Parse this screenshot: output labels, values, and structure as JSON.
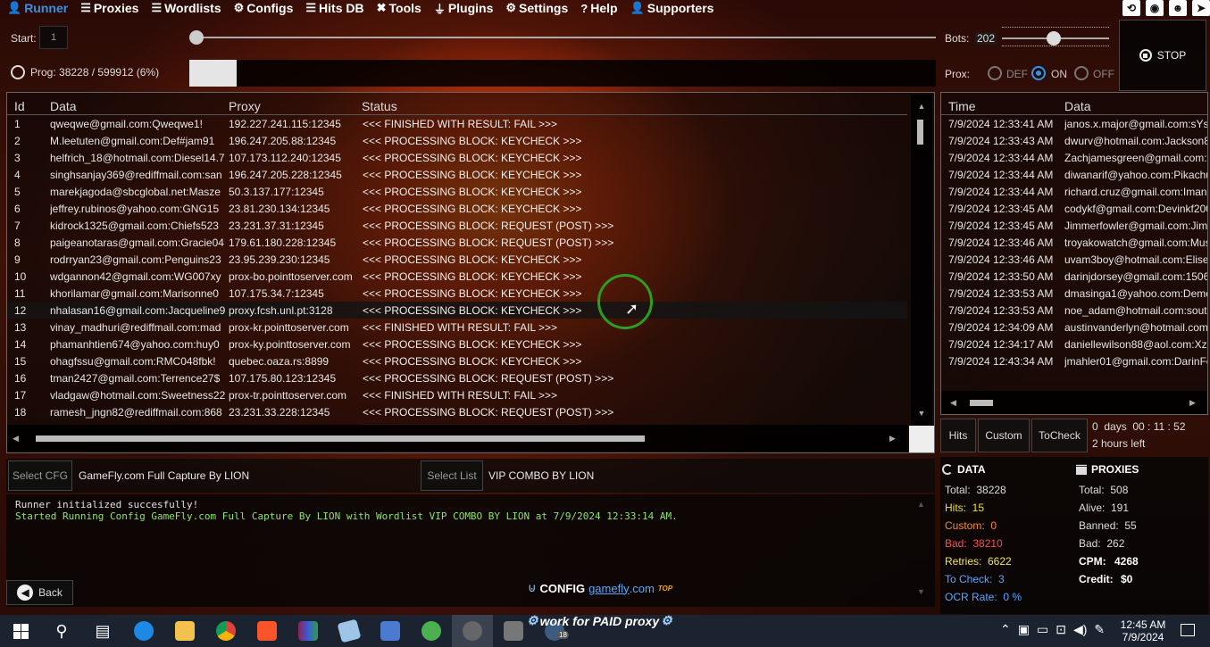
{
  "nav": {
    "items": [
      {
        "label": "Runner",
        "icon": "person-icon",
        "active": true
      },
      {
        "label": "Proxies",
        "icon": "list-icon"
      },
      {
        "label": "Wordlists",
        "icon": "list-icon"
      },
      {
        "label": "Configs",
        "icon": "gear-icon"
      },
      {
        "label": "Hits DB",
        "icon": "list-icon"
      },
      {
        "label": "Tools",
        "icon": "tools-icon"
      },
      {
        "label": "Plugins",
        "icon": "plug-icon"
      },
      {
        "label": "Settings",
        "icon": "gear-icon"
      },
      {
        "label": "Help",
        "icon": "help-icon"
      },
      {
        "label": "Supporters",
        "icon": "person-icon"
      }
    ],
    "right_icons": [
      "history-icon",
      "camera-icon",
      "discord-icon",
      "telegram-icon"
    ]
  },
  "runner": {
    "start_label": "Start:",
    "start_value": "1",
    "prog_label": "Prog: 38228 / 599912 (6%)",
    "progress_fraction": 0.0637,
    "bots_label": "Bots:",
    "bots_value": "202",
    "prox_label": "Prox:",
    "prox_options": [
      "DEF",
      "ON",
      "OFF"
    ],
    "prox_selected": "ON",
    "stop_label": "STOP"
  },
  "main_table": {
    "headers": [
      "Id",
      "Data",
      "Proxy",
      "Status"
    ],
    "rows": [
      [
        "1",
        "qweqwe@gmail.com:Qweqwe1!",
        "192.227.241.115:12345",
        "<<< FINISHED WITH RESULT: FAIL >>>"
      ],
      [
        "2",
        "M.leetuten@gmail.com:Def#jam91",
        "196.247.205.88:12345",
        "<<< PROCESSING BLOCK: KEYCHECK >>>"
      ],
      [
        "3",
        "helfrich_18@hotmail.com:Diesel14.7",
        "107.173.112.240:12345",
        "<<< PROCESSING BLOCK: KEYCHECK >>>"
      ],
      [
        "4",
        "singhsanjay369@rediffmail.com:san",
        "196.247.205.228:12345",
        "<<< PROCESSING BLOCK: KEYCHECK >>>"
      ],
      [
        "5",
        "marekjagoda@sbcglobal.net:Masze",
        "50.3.137.177:12345",
        "<<< PROCESSING BLOCK: KEYCHECK >>>"
      ],
      [
        "6",
        "jeffrey.rubinos@yahoo.com:GNG15",
        "23.81.230.134:12345",
        "<<< PROCESSING BLOCK: KEYCHECK >>>"
      ],
      [
        "7",
        "kidrock1325@gmail.com:Chiefs523",
        "23.231.37.31:12345",
        "<<< PROCESSING BLOCK: REQUEST (POST) >>>"
      ],
      [
        "8",
        "paigeanotaras@gmail.com:Gracie04",
        "179.61.180.228:12345",
        "<<< PROCESSING BLOCK: REQUEST (POST) >>>"
      ],
      [
        "9",
        "rodrryan23@gmail.com:Penguins23",
        "23.95.239.230:12345",
        "<<< PROCESSING BLOCK: KEYCHECK >>>"
      ],
      [
        "10",
        "wdgannon42@gmail.com:WG007xy",
        "prox-bo.pointtoserver.com",
        "<<< PROCESSING BLOCK: KEYCHECK >>>"
      ],
      [
        "11",
        "khorilamar@gmail.com:Marisonne0",
        "107.175.34.7:12345",
        "<<< PROCESSING BLOCK: KEYCHECK >>>"
      ],
      [
        "12",
        "nhalasan16@gmail.com:Jacqueline9",
        "proxy.fcsh.unl.pt:3128",
        "<<< PROCESSING BLOCK: KEYCHECK >>>"
      ],
      [
        "13",
        "vinay_madhuri@rediffmail.com:mad",
        "prox-kr.pointtoserver.com",
        "<<< FINISHED WITH RESULT: FAIL >>>"
      ],
      [
        "14",
        "phamanhtien674@yahoo.com:huy0",
        "prox-ky.pointtoserver.com",
        "<<< PROCESSING BLOCK: KEYCHECK >>>"
      ],
      [
        "15",
        "ohagfssu@gmail.com:RMC048fbk!",
        "quebec.oaza.rs:8899",
        "<<< PROCESSING BLOCK: KEYCHECK >>>"
      ],
      [
        "16",
        "tman2427@gmail.com:Terrence27$",
        "107.175.80.123:12345",
        "<<< PROCESSING BLOCK: REQUEST (POST) >>>"
      ],
      [
        "17",
        "vladgaw@hotmail.com:Sweetness22",
        "prox-tr.pointtoserver.com",
        "<<< FINISHED WITH RESULT: FAIL >>>"
      ],
      [
        "18",
        "ramesh_jngn82@rediffmail.com:868",
        "23.231.33.228:12345",
        "<<< PROCESSING BLOCK: REQUEST (POST) >>>"
      ]
    ],
    "selected_row": 11
  },
  "hits_table": {
    "headers": [
      "Time",
      "Data"
    ],
    "rows": [
      [
        "7/9/2024 12:33:41 AM",
        "janos.x.major@gmail.com:sYst"
      ],
      [
        "7/9/2024 12:33:43 AM",
        "dwurv@hotmail.com:Jackson8"
      ],
      [
        "7/9/2024 12:33:44 AM",
        "Zachjamesgreen@gmail.com:C"
      ],
      [
        "7/9/2024 12:33:44 AM",
        "diwanarif@yahoo.com:Pikachu"
      ],
      [
        "7/9/2024 12:33:44 AM",
        "richard.cruz@gmail.com:Imani"
      ],
      [
        "7/9/2024 12:33:45 AM",
        "codykf@gmail.com:Devinkf200"
      ],
      [
        "7/9/2024 12:33:45 AM",
        "Jimmerfowler@gmail.com:Jimi"
      ],
      [
        "7/9/2024 12:33:46 AM",
        "troyakowatch@gmail.com:Mus"
      ],
      [
        "7/9/2024 12:33:46 AM",
        "uvam3boy@hotmail.com:Elise"
      ],
      [
        "7/9/2024 12:33:50 AM",
        "darinjdorsey@gmail.com:1506"
      ],
      [
        "7/9/2024 12:33:53 AM",
        "dmasinga1@yahoo.com:Demo"
      ],
      [
        "7/9/2024 12:33:53 AM",
        "noe_adam@hotmail.com:south"
      ],
      [
        "7/9/2024 12:34:09 AM",
        "austinvanderlyn@hotmail.com"
      ],
      [
        "7/9/2024 12:34:17 AM",
        "daniellewilson88@aol.com:Xza"
      ],
      [
        "7/9/2024 12:43:34 AM",
        "jmahler01@gmail.com:DarinFc"
      ]
    ],
    "tabs": [
      "Hits",
      "Custom",
      "ToCheck"
    ],
    "timer": "0  days  00 : 11 : 52",
    "time_left": "2 hours left"
  },
  "config": {
    "select_cfg_label": "Select CFG",
    "cfg_value": "GameFly.com Full Capture By LION",
    "select_list_label": "Select List",
    "list_value": "VIP COMBO BY LION"
  },
  "log": {
    "line1": "Runner initialized succesfully!",
    "line2": "Started Running Config GameFly.com Full Capture By LION with Wordlist VIP COMBO BY LION at 7/9/2024 12:33:14 AM."
  },
  "back_label": "Back",
  "banner": {
    "prefix": "CONFIG",
    "domain_name": "gamefly",
    "domain_tld": ".com",
    "badge": "TOP"
  },
  "data_stats": {
    "title": "DATA",
    "total": "Total:  38228",
    "hits": "Hits:  15",
    "custom": "Custom:  0",
    "bad": "Bad:  38210",
    "retries": "Retries:  6622",
    "tocheck": "To Check:  3",
    "ocr": "OCR Rate:  0 %"
  },
  "proxy_stats": {
    "title": "PROXIES",
    "total": "Total:  508",
    "alive": "Alive:  191",
    "banned": "Banned:  55",
    "bad": "Bad:  262",
    "cpm_label": "CPM:",
    "cpm_value": "4268",
    "credit_label": "Credit:",
    "credit_value": "$0"
  },
  "taskbar": {
    "window_title": "work for PAID proxy",
    "badge_count": "18",
    "clock_time": "12:45 AM",
    "clock_date": "7/9/2024"
  },
  "colors": {
    "accent_blue": "#3b8fe0",
    "hits_yellow": "#e8e040",
    "custom_orange": "#f08a3a",
    "bad_red": "#ff4d4d",
    "retries_yellow": "#f3e35a",
    "tocheck_blue": "#57a7ff",
    "log_green": "#8fe36a"
  }
}
